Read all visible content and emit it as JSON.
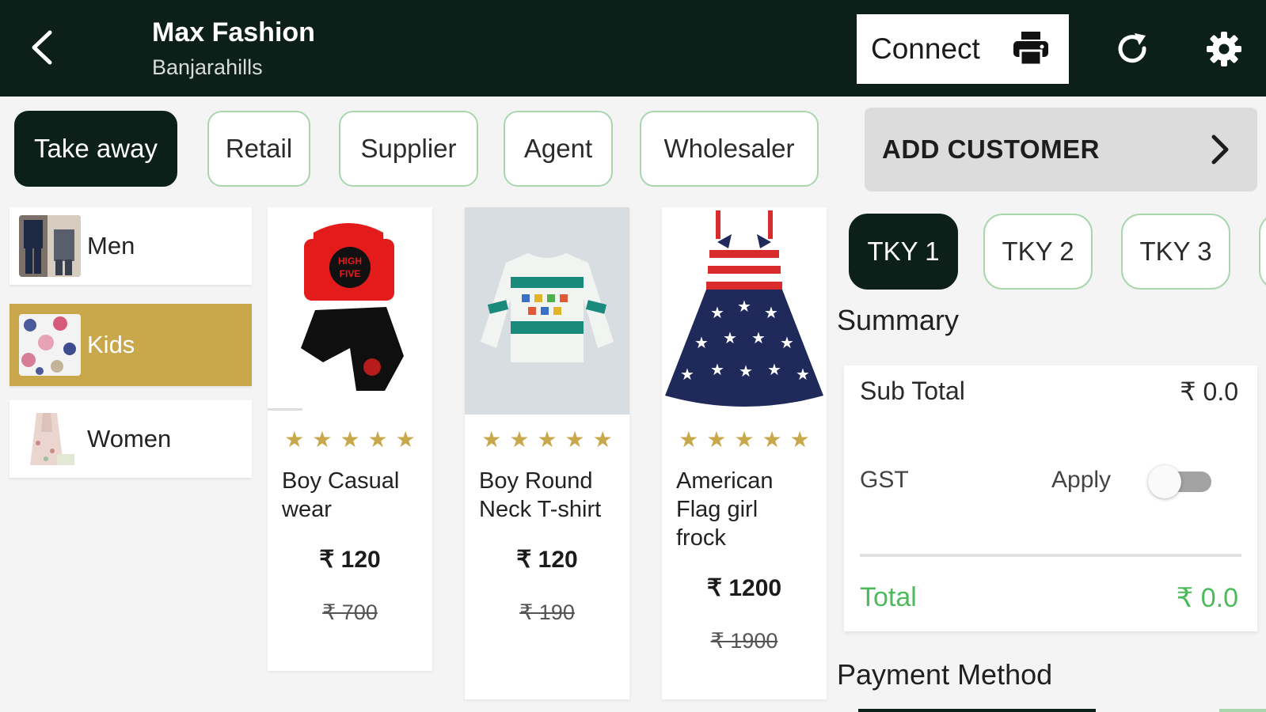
{
  "header": {
    "store_name": "Max Fashion",
    "branch": "Banjarahills",
    "connect_label": "Connect"
  },
  "customer_types": [
    "Take away",
    "Retail",
    "Supplier",
    "Agent",
    "Wholesaler"
  ],
  "active_customer_type": "Take away",
  "add_customer_label": "ADD CUSTOMER",
  "categories": [
    {
      "label": "Men"
    },
    {
      "label": "Kids"
    },
    {
      "label": "Women"
    }
  ],
  "active_category": "Kids",
  "products": [
    {
      "name": "Boy Casual wear",
      "price": "₹ 120",
      "mrp": "₹ 700",
      "rating": 5
    },
    {
      "name": "Boy Round Neck T-shirt",
      "price": "₹ 120",
      "mrp": "₹ 190",
      "rating": 5
    },
    {
      "name": "American Flag girl frock",
      "price": "₹ 1200",
      "mrp": "₹ 1900",
      "rating": 5
    }
  ],
  "tickets": [
    "TKY 1",
    "TKY 2",
    "TKY 3"
  ],
  "active_ticket": "TKY 1",
  "summary": {
    "title": "Summary",
    "subtotal_label": "Sub Total",
    "subtotal_value": "₹ 0.0",
    "gst_label": "GST",
    "apply_label": "Apply",
    "gst_applied": false,
    "total_label": "Total",
    "total_value": "₹ 0.0"
  },
  "payment_method_title": "Payment Method",
  "colors": {
    "header_bg": "#0c2019",
    "accent_gold": "#c9a84c",
    "chip_border": "#a9d6ad",
    "total_green": "#4cbb5b"
  }
}
